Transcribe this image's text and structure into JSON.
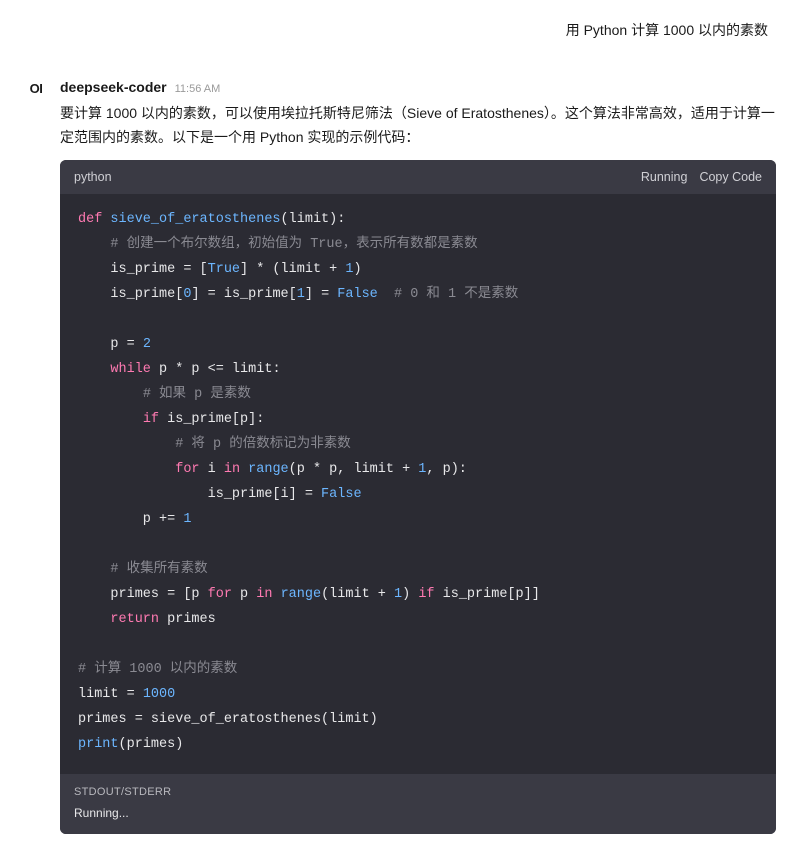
{
  "user": {
    "message": "用 Python 计算 1000 以内的素数"
  },
  "assistant": {
    "avatar_text": "OI",
    "name": "deepseek-coder",
    "timestamp": "11:56 AM",
    "intro": "要计算 1000 以内的素数，可以使用埃拉托斯特尼筛法（Sieve of Eratosthenes）。这个算法非常高效，适用于计算一定范围内的素数。以下是一个用 Python 实现的示例代码："
  },
  "code_block": {
    "language": "python",
    "actions": {
      "running": "Running",
      "copy": "Copy Code"
    },
    "lines": [
      [
        {
          "t": "kw",
          "v": "def "
        },
        {
          "t": "fn",
          "v": "sieve_of_eratosthenes"
        },
        {
          "t": "",
          "v": "(limit):"
        }
      ],
      [
        {
          "t": "",
          "v": "    "
        },
        {
          "t": "comm",
          "v": "# 创建一个布尔数组，初始值为 True，表示所有数都是素数"
        }
      ],
      [
        {
          "t": "",
          "v": "    is_prime = ["
        },
        {
          "t": "const",
          "v": "True"
        },
        {
          "t": "",
          "v": "] * (limit + "
        },
        {
          "t": "num",
          "v": "1"
        },
        {
          "t": "",
          "v": ")"
        }
      ],
      [
        {
          "t": "",
          "v": "    is_prime["
        },
        {
          "t": "num",
          "v": "0"
        },
        {
          "t": "",
          "v": "] = is_prime["
        },
        {
          "t": "num",
          "v": "1"
        },
        {
          "t": "",
          "v": "] = "
        },
        {
          "t": "const",
          "v": "False"
        },
        {
          "t": "",
          "v": "  "
        },
        {
          "t": "comm",
          "v": "# 0 和 1 不是素数"
        }
      ],
      [
        {
          "t": "",
          "v": ""
        }
      ],
      [
        {
          "t": "",
          "v": "    p = "
        },
        {
          "t": "num",
          "v": "2"
        }
      ],
      [
        {
          "t": "",
          "v": "    "
        },
        {
          "t": "kw",
          "v": "while"
        },
        {
          "t": "",
          "v": " p * p <= limit:"
        }
      ],
      [
        {
          "t": "",
          "v": "        "
        },
        {
          "t": "comm",
          "v": "# 如果 p 是素数"
        }
      ],
      [
        {
          "t": "",
          "v": "        "
        },
        {
          "t": "kw",
          "v": "if"
        },
        {
          "t": "",
          "v": " is_prime[p]:"
        }
      ],
      [
        {
          "t": "",
          "v": "            "
        },
        {
          "t": "comm",
          "v": "# 将 p 的倍数标记为非素数"
        }
      ],
      [
        {
          "t": "",
          "v": "            "
        },
        {
          "t": "kw",
          "v": "for"
        },
        {
          "t": "",
          "v": " i "
        },
        {
          "t": "kw",
          "v": "in"
        },
        {
          "t": "",
          "v": " "
        },
        {
          "t": "fn",
          "v": "range"
        },
        {
          "t": "",
          "v": "(p * p, limit + "
        },
        {
          "t": "num",
          "v": "1"
        },
        {
          "t": "",
          "v": ", p):"
        }
      ],
      [
        {
          "t": "",
          "v": "                is_prime[i] = "
        },
        {
          "t": "const",
          "v": "False"
        }
      ],
      [
        {
          "t": "",
          "v": "        p += "
        },
        {
          "t": "num",
          "v": "1"
        }
      ],
      [
        {
          "t": "",
          "v": ""
        }
      ],
      [
        {
          "t": "",
          "v": "    "
        },
        {
          "t": "comm",
          "v": "# 收集所有素数"
        }
      ],
      [
        {
          "t": "",
          "v": "    primes = [p "
        },
        {
          "t": "kw",
          "v": "for"
        },
        {
          "t": "",
          "v": " p "
        },
        {
          "t": "kw",
          "v": "in"
        },
        {
          "t": "",
          "v": " "
        },
        {
          "t": "fn",
          "v": "range"
        },
        {
          "t": "",
          "v": "(limit + "
        },
        {
          "t": "num",
          "v": "1"
        },
        {
          "t": "",
          "v": ") "
        },
        {
          "t": "kw",
          "v": "if"
        },
        {
          "t": "",
          "v": " is_prime[p]]"
        }
      ],
      [
        {
          "t": "",
          "v": "    "
        },
        {
          "t": "kw",
          "v": "return"
        },
        {
          "t": "",
          "v": " primes"
        }
      ],
      [
        {
          "t": "",
          "v": ""
        }
      ],
      [
        {
          "t": "comm",
          "v": "# 计算 1000 以内的素数"
        }
      ],
      [
        {
          "t": "",
          "v": "limit = "
        },
        {
          "t": "num",
          "v": "1000"
        }
      ],
      [
        {
          "t": "",
          "v": "primes = sieve_of_eratosthenes(limit)"
        }
      ],
      [
        {
          "t": "fn",
          "v": "print"
        },
        {
          "t": "",
          "v": "(primes)"
        }
      ]
    ]
  },
  "output": {
    "label": "STDOUT/STDERR",
    "text": "Running..."
  }
}
